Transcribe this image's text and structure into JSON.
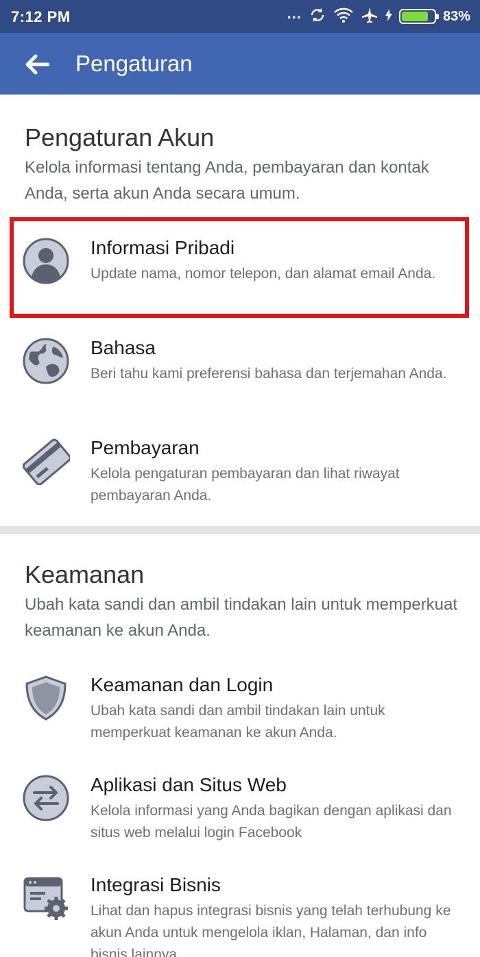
{
  "status_bar": {
    "time": "7:12 PM",
    "dots": "...",
    "battery_percent": "83%",
    "battery_level": 0.83
  },
  "app_bar": {
    "title": "Pengaturan",
    "back_icon": "arrow-left-icon"
  },
  "colors": {
    "status_bar": "#2f4a84",
    "app_bar": "#4267b2",
    "highlight": "#e0161b",
    "icon_fill": "#c6ccd8",
    "icon_stroke": "#5a6272"
  },
  "sections": [
    {
      "title": "Pengaturan Akun",
      "description": "Kelola informasi tentang Anda, pembayaran dan kontak Anda, serta akun Anda secara umum.",
      "items": [
        {
          "title": "Informasi Pribadi",
          "description": "Update nama, nomor telepon, dan alamat email Anda.",
          "icon": "person-icon",
          "highlighted": true
        },
        {
          "title": "Bahasa",
          "description": "Beri tahu kami preferensi bahasa dan terjemahan Anda.",
          "icon": "globe-icon"
        },
        {
          "title": "Pembayaran",
          "description": "Kelola pengaturan pembayaran dan lihat riwayat pembayaran Anda.",
          "icon": "credit-card-icon"
        }
      ]
    },
    {
      "title": "Keamanan",
      "description": "Ubah kata sandi dan ambil tindakan lain untuk memperkuat keamanan ke akun Anda.",
      "items": [
        {
          "title": "Keamanan dan Login",
          "description": "Ubah kata sandi dan ambil tindakan lain untuk memperkuat keamanan ke akun Anda.",
          "icon": "shield-icon"
        },
        {
          "title": "Aplikasi dan Situs Web",
          "description": "Kelola informasi yang Anda bagikan dengan aplikasi dan situs web melalui login Facebook",
          "icon": "swap-arrows-icon"
        },
        {
          "title": "Integrasi Bisnis",
          "description": "Lihat dan hapus integrasi bisnis yang telah terhubung ke akun Anda untuk mengelola iklan, Halaman, dan info bisnis lainnya.",
          "icon": "business-settings-icon"
        }
      ]
    }
  ]
}
